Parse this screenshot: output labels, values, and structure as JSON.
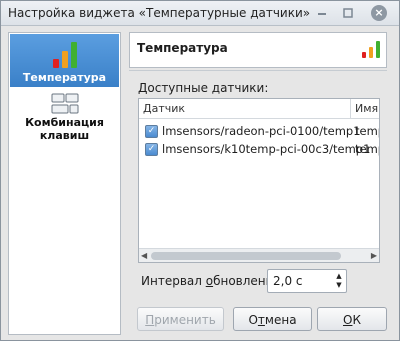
{
  "window": {
    "title": "Настройка виджета «Температурные датчики»"
  },
  "sidebar": {
    "items": [
      {
        "label": "Температура",
        "icon": "signal-bars-icon",
        "active": true
      },
      {
        "label": "Комбинация клавиш",
        "icon": "keyboard-keys-icon",
        "active": false
      }
    ]
  },
  "header": {
    "title": "Температура"
  },
  "sensors": {
    "label_prefix": "",
    "label_underlined": "Д",
    "label_rest": "оступные датчики:",
    "columns": [
      "Датчик",
      "Имя"
    ],
    "rows": [
      {
        "checked": true,
        "sensor": "lmsensors/radeon-pci-0100/temp1",
        "name": "temp"
      },
      {
        "checked": true,
        "sensor": "lmsensors/k10temp-pci-00c3/temp1",
        "name": "temp"
      }
    ]
  },
  "interval": {
    "label_before": "Интервал ",
    "label_underlined": "о",
    "label_after": "бновления:",
    "value": "2,0 с"
  },
  "buttons": {
    "apply_underlined": "П",
    "apply_rest": "рименить",
    "cancel_before": "О",
    "cancel_underlined": "т",
    "cancel_after": "мена",
    "ok_underlined": "О",
    "ok_rest": "К"
  },
  "colors": {
    "accent": "#3a80c8",
    "bar_red": "#e02020",
    "bar_orange": "#f0a020",
    "bar_green": "#40b030"
  }
}
